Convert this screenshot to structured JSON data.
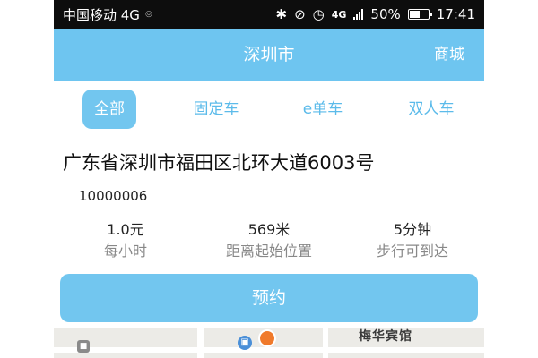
{
  "status_bar": {
    "carrier": "中国移动 4G",
    "network_right": "4G",
    "battery_percent": "50%",
    "battery_level": 0.5,
    "time": "17:41",
    "icons": [
      "bluetooth-icon",
      "mute-icon",
      "alarm-icon",
      "signal-icon",
      "battery-icon"
    ]
  },
  "header": {
    "title": "深圳市",
    "right_link": "商城",
    "color": "#6ec5f0"
  },
  "tabs": [
    {
      "label": "全部",
      "active": true
    },
    {
      "label": "固定车",
      "active": false
    },
    {
      "label": "e单车",
      "active": false
    },
    {
      "label": "双人车",
      "active": false
    }
  ],
  "info": {
    "address": "广东省深圳市福田区北环大道6003号",
    "code": "10000006",
    "stats": [
      {
        "value": "1.0元",
        "label": "每小时"
      },
      {
        "value": "569米",
        "label": "距离起始位置"
      },
      {
        "value": "5分钟",
        "label": "步行可到达"
      }
    ]
  },
  "actions": {
    "reserve_label": "预约",
    "accent_color": "#72c6ef"
  },
  "map": {
    "label": "梅华宾馆",
    "icons": [
      "poi-icon",
      "bus-stop-icon",
      "location-pin-icon"
    ]
  }
}
